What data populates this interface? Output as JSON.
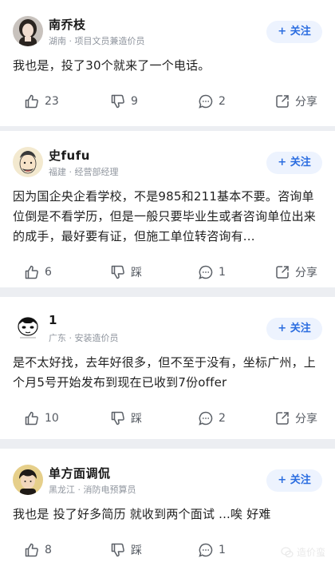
{
  "follow_label": "+ 关注",
  "posts": [
    {
      "name": "南乔枝",
      "meta": "湖南 · 项目文员兼造价员",
      "content": "我也是，投了30个就来了一个电话。",
      "like": "23",
      "dislike": "9",
      "comment": "2",
      "share": "分享"
    },
    {
      "name": "史fufu",
      "meta": "福建 · 经营部经理",
      "content": "因为国企央企看学校，不是985和211基本不要。咨询单位倒是不看学历，但是一般只要毕业生或者咨询单位出来的成手，最好要有证，但施工单位转咨询有...",
      "like": "6",
      "dislike": "踩",
      "comment": "1",
      "share": "分享"
    },
    {
      "name": "1",
      "meta": "广东 · 安装造价员",
      "content": "是不太好找，去年好很多，但不至于没有，坐标广州，上个月5号开始发布到现在已收到7份offer",
      "like": "10",
      "dislike": "踩",
      "comment": "2",
      "share": "分享"
    },
    {
      "name": "单方面调侃",
      "meta": "黑龙江 · 消防电预算员",
      "content": "我也是 投了好多简历 就收到两个面试 ...唉 好难",
      "like": "8",
      "dislike": "踩",
      "comment": "1",
      "share": "分享"
    }
  ],
  "watermark": "造价蛮",
  "colors": {
    "accent": "#2b6de0",
    "follow_bg": "#edf3fe",
    "divider": "#eceef2",
    "meta_text": "#8f959e"
  },
  "icons": [
    "thumb-up-icon",
    "thumb-down-icon",
    "comment-icon",
    "share-icon"
  ]
}
